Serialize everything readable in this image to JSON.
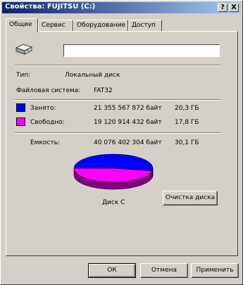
{
  "window": {
    "title": "Свойства: FUJITSU (C:)",
    "help_btn": "?",
    "close_btn": "X"
  },
  "tabs": [
    {
      "label": "Общие",
      "active": true
    },
    {
      "label": "Сервис",
      "active": false
    },
    {
      "label": "Оборудование",
      "active": false
    },
    {
      "label": "Доступ",
      "active": false
    }
  ],
  "general": {
    "drive_icon": "hard-drive-icon",
    "name_value": "",
    "type_label": "Тип:",
    "type_value": "Локальный диск",
    "fs_label": "Файловая система:",
    "fs_value": "FAT32",
    "used": {
      "label": "Занято:",
      "bytes": "21 355 567 872 байт",
      "size": "20,3 ГБ",
      "color": "#0000ff"
    },
    "free": {
      "label": "Свободно:",
      "bytes": "19 120 914 432 байт",
      "size": "17,8 ГБ",
      "color": "#ff00ff"
    },
    "capacity": {
      "label": "Емкость:",
      "bytes": "40 076 402 304 байт",
      "size": "30,1 ГБ"
    },
    "disk_label": "Диск C",
    "cleanup_btn": "Очистка диска",
    "used_fraction": 0.53
  },
  "footer": {
    "ok": "ОК",
    "cancel": "Отмена",
    "apply": "Применить"
  }
}
